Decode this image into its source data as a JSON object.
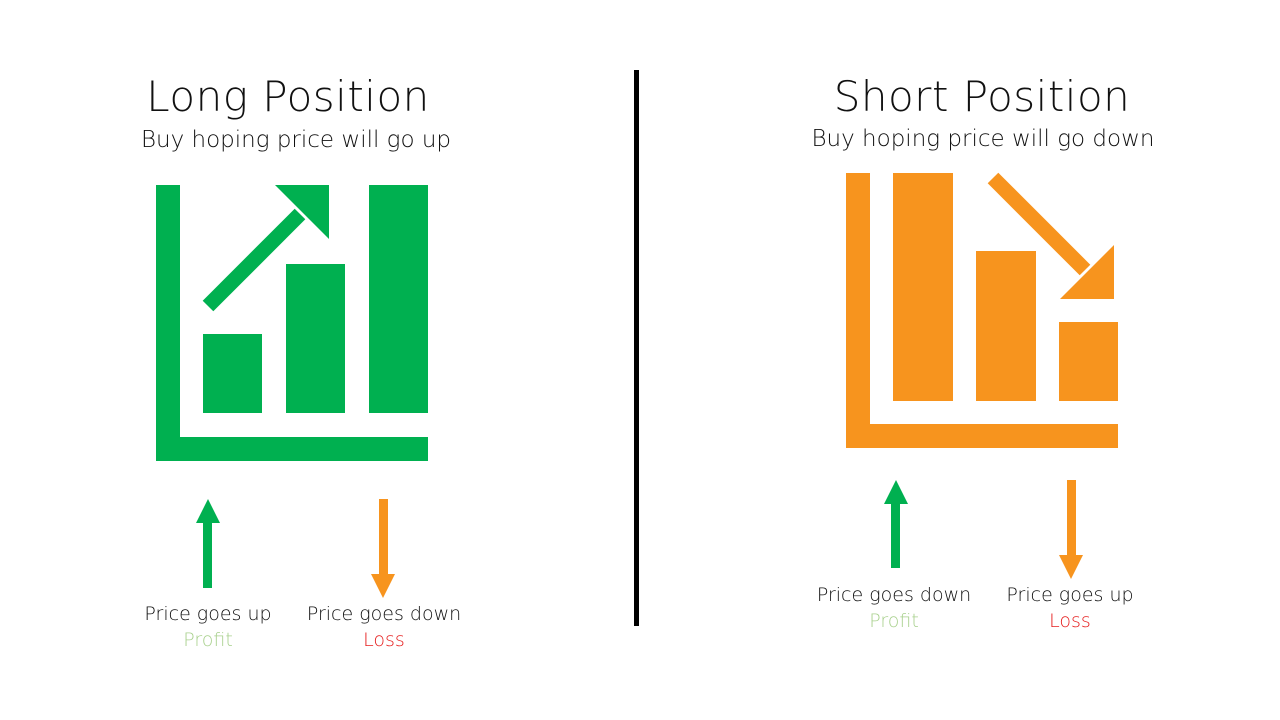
{
  "colors": {
    "long_green": "#00b050",
    "short_orange": "#f7941e",
    "profit_text": "#a9d18e",
    "loss_text": "#e61e1e",
    "divider": "#000000"
  },
  "long": {
    "title": "Long Position",
    "subtitle": "Buy hoping price will go up",
    "chart_icon": "rising-bar-chart-icon",
    "outcomes": [
      {
        "caption": "Price goes up",
        "result": "Profit",
        "arrow": "up-arrow-icon"
      },
      {
        "caption": "Price goes down",
        "result": "Loss",
        "arrow": "down-arrow-icon"
      }
    ]
  },
  "short": {
    "title": "Short Position",
    "subtitle": "Buy hoping price will go down",
    "chart_icon": "falling-bar-chart-icon",
    "outcomes": [
      {
        "caption": "Price goes down",
        "result": "Profit",
        "arrow": "up-arrow-icon"
      },
      {
        "caption": "Price goes up",
        "result": "Loss",
        "arrow": "down-arrow-icon"
      }
    ]
  }
}
